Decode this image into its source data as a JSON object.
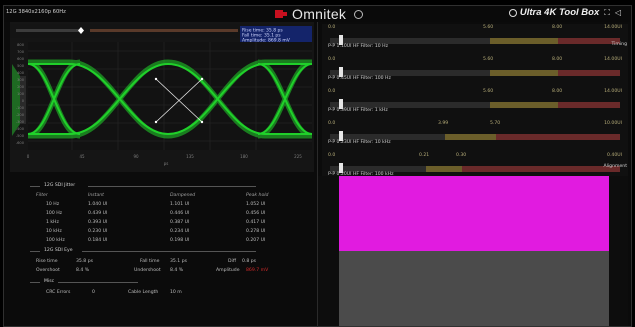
{
  "header": {
    "resolution_label": "12G 3840x2160p 60Hz",
    "brand_name": "Omnitek",
    "product_name": "Ultra 4K Tool Box"
  },
  "eye_panel": {
    "info_box": {
      "rise_time": "Rise time: 35.8 ps",
      "fall_time": "Fall time: 35.1 ps",
      "amplitude": "Amplitude: 869.8 mV"
    },
    "x_ticks": [
      "0",
      "45",
      "90",
      "135",
      "180",
      "225"
    ],
    "x_unit": "ps",
    "y_ticks": [
      "800",
      "700",
      "600",
      "500",
      "400",
      "300",
      "200",
      "100",
      "0",
      "-100",
      "-200",
      "-300",
      "-400",
      "-500",
      "-600"
    ]
  },
  "filters": [
    {
      "label": "P-P 1.10UI HF Filter: 10 Hz",
      "scale": [
        "0.0",
        "5.60",
        "8.00",
        "14.00UI"
      ],
      "tag": "Timing",
      "level": 0.03
    },
    {
      "label": "P-P 0.45UI HF Filter: 100 Hz",
      "scale": [
        "0.0",
        "5.60",
        "8.00",
        "14.00UI"
      ],
      "tag": "",
      "level": 0.03
    },
    {
      "label": "P-P 0.39UI HF Filter: 1 kHz",
      "scale": [
        "0.0",
        "5.60",
        "8.00",
        "14.00UI"
      ],
      "tag": "",
      "level": 0.03
    },
    {
      "label": "P-P 0.23UI HF Filter: 10 kHz",
      "scale": [
        "0.0",
        "3.99",
        "5.70",
        "10.00UI"
      ],
      "tag": "",
      "level": 0.03
    },
    {
      "label": "P-P 0.20UI HF Filter: 100 kHz",
      "scale": [
        "0.0",
        "0.21",
        "0.30",
        "0.40UI"
      ],
      "tag": "Alignment",
      "level": 0.03
    }
  ],
  "jitter": {
    "title": "12G SDI Jitter",
    "headers": [
      "Filter",
      "Instant",
      "Dampened",
      "Peak hold"
    ],
    "rows": [
      [
        "10 Hz",
        "1.040 UI",
        "1.101 UI",
        "1.052 UI"
      ],
      [
        "100 Hz",
        "0.439 UI",
        "0.446 UI",
        "0.456 UI"
      ],
      [
        "1 kHz",
        "0.393 UI",
        "0.387 UI",
        "0.417 UI"
      ],
      [
        "10 kHz",
        "0.230 UI",
        "0.234 UI",
        "0.278 UI"
      ],
      [
        "100 kHz",
        "0.184 UI",
        "0.198 UI",
        "0.207 UI"
      ]
    ]
  },
  "eye": {
    "title": "12G SDI Eye",
    "rise_time_label": "Rise time",
    "rise_time_value": "35.8 ps",
    "fall_time_label": "Fall time",
    "fall_time_value": "35.1 ps",
    "diff_label": "Diff",
    "diff_value": "0.8 ps",
    "overshoot_label": "Overshoot",
    "overshoot_value": "8.4 %",
    "undershoot_label": "Undershoot",
    "undershoot_value": "8.4 %",
    "amplitude_label": "Amplitude",
    "amplitude_value": "869.7 mV",
    "amplitude_color": "#d22a2a"
  },
  "misc": {
    "title": "Misc",
    "crc_label": "CRC Errors",
    "crc_value": "0",
    "cable_label": "Cable Length",
    "cable_value": "10 m"
  },
  "colors": {
    "eye_green": "#21d62b",
    "swatch_magenta": "#e11be0",
    "swatch_gray": "#4b4b4b",
    "scale_amber": "#b8ae7a"
  }
}
